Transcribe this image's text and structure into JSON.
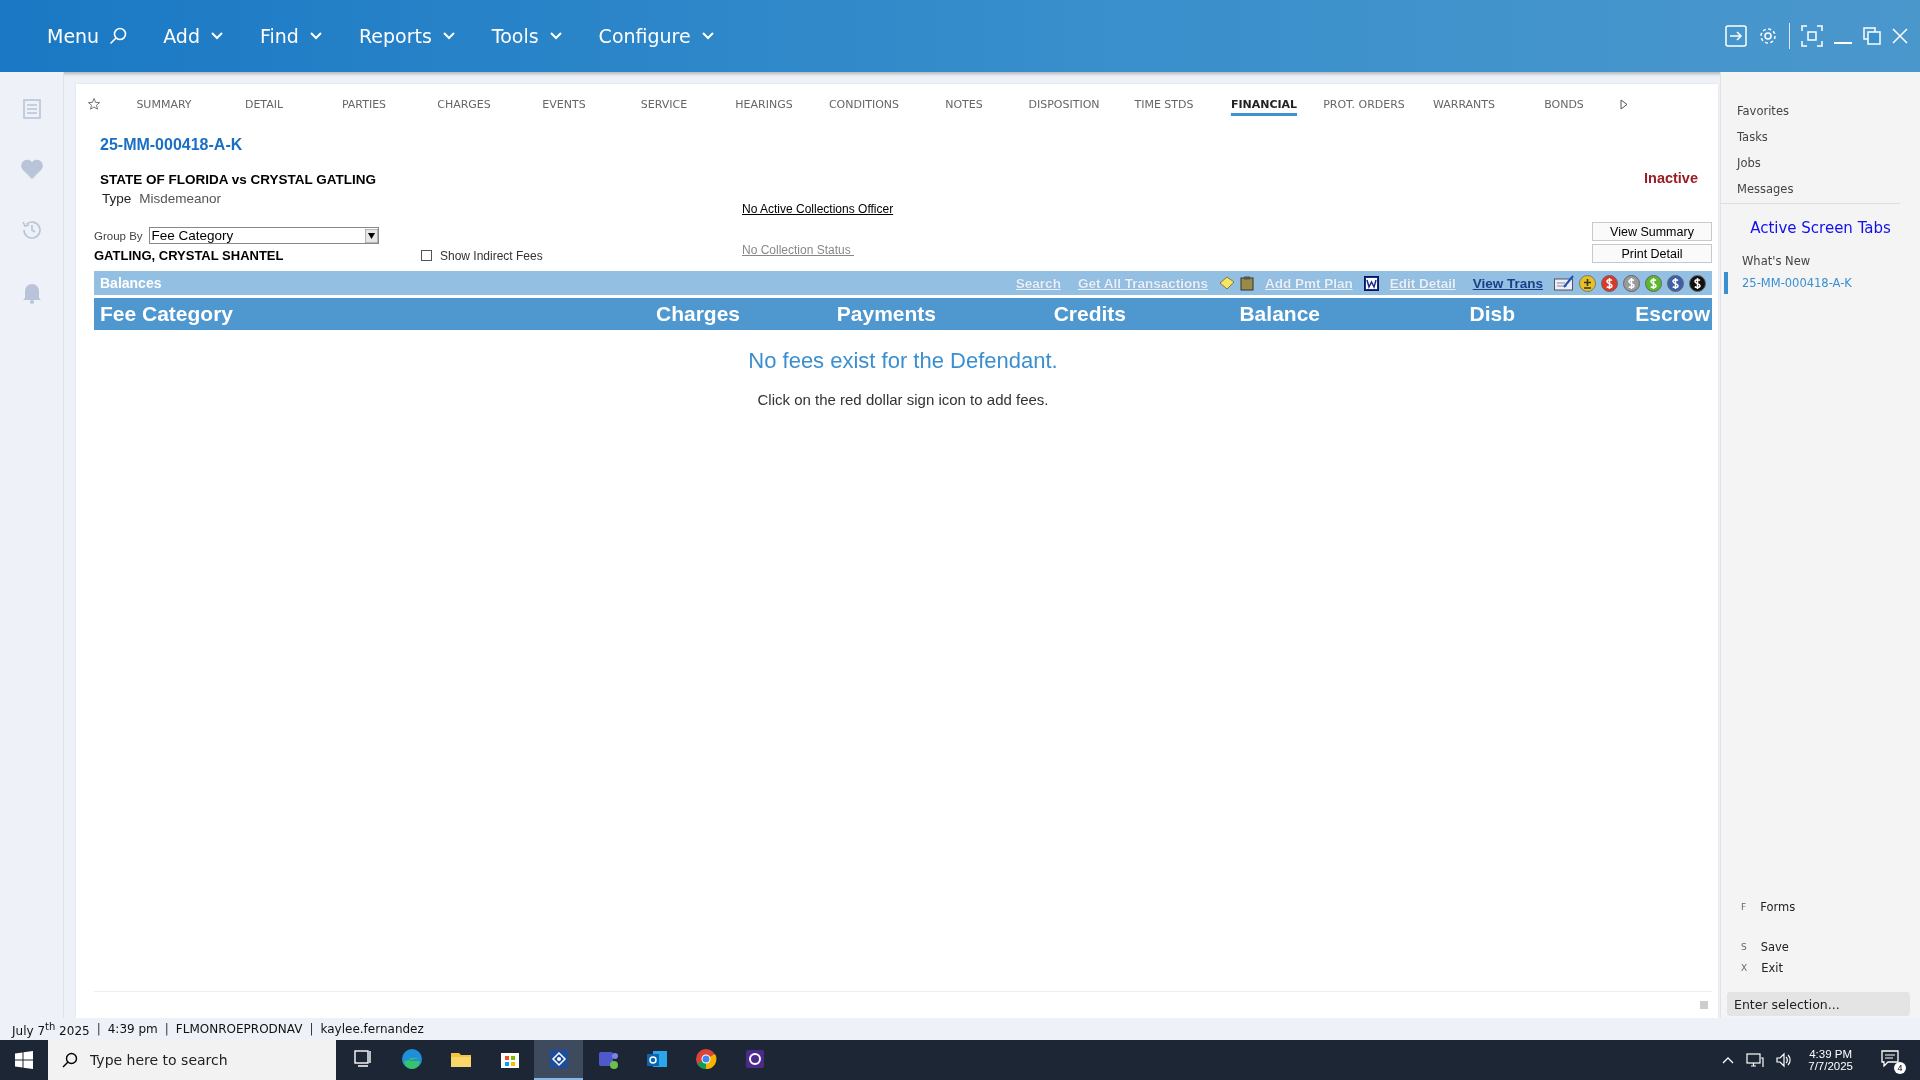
{
  "top_menu": [
    {
      "label": "Menu",
      "kind": "search"
    },
    {
      "label": "Add",
      "kind": "dropdown"
    },
    {
      "label": "Find",
      "kind": "dropdown"
    },
    {
      "label": "Reports",
      "kind": "dropdown"
    },
    {
      "label": "Tools",
      "kind": "dropdown"
    },
    {
      "label": "Configure",
      "kind": "dropdown"
    }
  ],
  "tabs": [
    {
      "label": "SUMMARY",
      "selected": false
    },
    {
      "label": "DETAIL",
      "selected": false
    },
    {
      "label": "PARTIES",
      "selected": false
    },
    {
      "label": "CHARGES",
      "selected": false
    },
    {
      "label": "EVENTS",
      "selected": false
    },
    {
      "label": "SERVICE",
      "selected": false
    },
    {
      "label": "HEARINGS",
      "selected": false
    },
    {
      "label": "CONDITIONS",
      "selected": false
    },
    {
      "label": "NOTES",
      "selected": false
    },
    {
      "label": "DISPOSITION",
      "selected": false
    },
    {
      "label": "TIME STDS",
      "selected": false
    },
    {
      "label": "FINANCIAL",
      "selected": true
    },
    {
      "label": "PROT. ORDERS",
      "selected": false
    },
    {
      "label": "WARRANTS",
      "selected": false
    },
    {
      "label": "BONDS",
      "selected": false
    }
  ],
  "case": {
    "number": "25-MM-000418-A-K",
    "title": "STATE OF FLORIDA vs CRYSTAL GATLING",
    "type_label": "Type",
    "type": "Misdemeanor",
    "status": "Inactive"
  },
  "collections_officer": "No Active Collections Officer",
  "collection_status": "No Collection Status ",
  "group_by": {
    "label": "Group By",
    "value": "Fee Category"
  },
  "defendant": "GATLING, CRYSTAL SHANTEL",
  "show_indirect_fees": {
    "label": "Show Indirect Fees",
    "checked": false
  },
  "buttons": [
    "View Summary",
    "Print Detail"
  ],
  "balances_bar": {
    "title": "Balances",
    "tools": [
      {
        "kind": "link",
        "label": "Search",
        "disabled": true
      },
      {
        "kind": "link",
        "label": "Get All Transactions",
        "disabled": true
      },
      {
        "kind": "note"
      },
      {
        "kind": "clipboard"
      },
      {
        "kind": "link",
        "label": "Add Pmt Plan",
        "disabled": true
      },
      {
        "kind": "word"
      },
      {
        "kind": "link",
        "label": "Edit Detail",
        "disabled": true
      },
      {
        "kind": "link",
        "label": "View Trans",
        "disabled": false
      },
      {
        "kind": "check"
      },
      {
        "kind": "plus",
        "color": "#e8c21c"
      },
      {
        "kind": "coin",
        "color": "#d8392b"
      },
      {
        "kind": "coin",
        "color": "#9a9a9a"
      },
      {
        "kind": "coin",
        "color": "#5cb82c"
      },
      {
        "kind": "coin",
        "color": "#3e5fa8"
      },
      {
        "kind": "coin",
        "color": "#111111"
      }
    ]
  },
  "table": {
    "columns": [
      "Fee Category",
      "Charges",
      "Payments",
      "Credits",
      "Balance",
      "Disb",
      "Escrow"
    ],
    "empty_title": "No fees exist for the Defendant.",
    "empty_hint": "Click on the red dollar sign icon to add fees."
  },
  "sidebar": {
    "items": [
      "Favorites",
      "Tasks",
      "Jobs",
      "Messages"
    ],
    "heading": "Active Screen Tabs",
    "screen_tabs": [
      {
        "label": "What's New",
        "selected": false
      },
      {
        "label": "25-MM-000418-A-K",
        "selected": true
      }
    ],
    "shortcuts": [
      {
        "key": "F",
        "label": "Forms"
      },
      {
        "key": "S",
        "label": "Save"
      },
      {
        "key": "X",
        "label": "Exit"
      }
    ],
    "input": {
      "placeholder": "Enter selection..."
    }
  },
  "status_bar": {
    "separator": "|",
    "items": [
      "July 7$^{th}$ 2025",
      "4:39 pm",
      "FLMONROEPRODNAV",
      "kaylee.fernandez"
    ]
  },
  "taskbar": {
    "search": {
      "placeholder": "Type here to search"
    },
    "apps": [
      {
        "kind": "taskview",
        "selected": false
      },
      {
        "kind": "edge",
        "selected": false
      },
      {
        "kind": "folder",
        "selected": false
      },
      {
        "kind": "store",
        "selected": false
      },
      {
        "kind": "grid",
        "selected": true
      },
      {
        "kind": "teams",
        "selected": false
      },
      {
        "kind": "outlook",
        "selected": false
      },
      {
        "kind": "chrome",
        "selected": false
      },
      {
        "kind": "purple",
        "selected": false
      }
    ],
    "time": "4:39 PM",
    "date": "7/7/2025",
    "notifications": "4"
  }
}
